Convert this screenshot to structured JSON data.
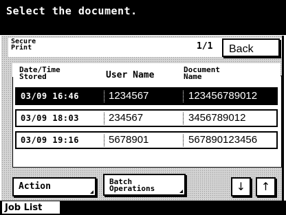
{
  "header": {
    "title": "Select the document."
  },
  "top": {
    "secure_label_1": "Secure",
    "secure_label_2": "Print",
    "page_indicator": "1/1",
    "back_label": "Back"
  },
  "columns": {
    "date_1": "Date/Time",
    "date_2": "Stored",
    "user": "User Name",
    "doc_1": "Document",
    "doc_2": "Name"
  },
  "rows": [
    {
      "date": "03/09  16:46",
      "user": "1234567",
      "doc": "123456789012",
      "selected": true
    },
    {
      "date": "03/09  18:03",
      "user": "234567",
      "doc": "3456789012",
      "selected": false
    },
    {
      "date": "03/09  19:16",
      "user": "5678901",
      "doc": "567890123456",
      "selected": false
    }
  ],
  "buttons": {
    "action": "Action",
    "batch_1": "Batch",
    "batch_2": "Operations",
    "down": "↓",
    "up": "↑"
  },
  "footer": {
    "job_list": "Job List"
  }
}
